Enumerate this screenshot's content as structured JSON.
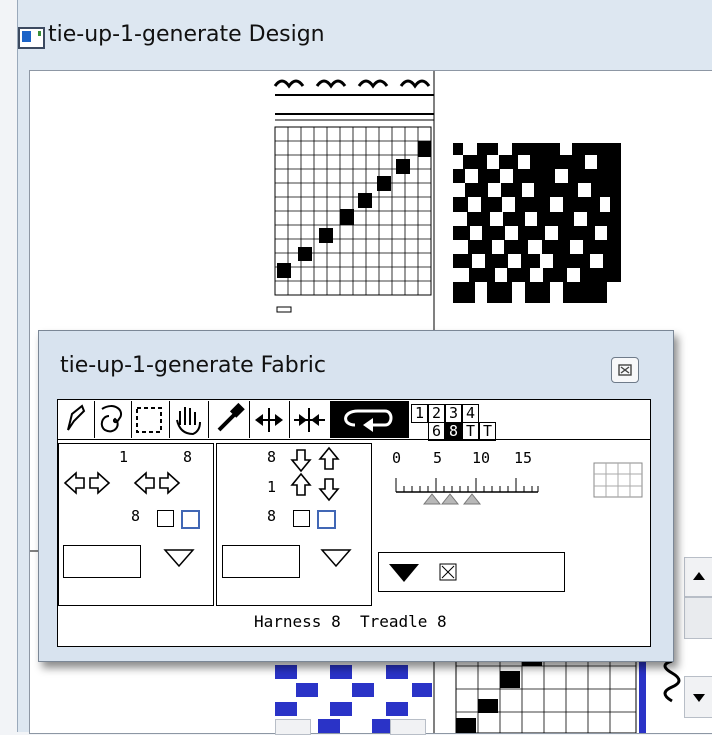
{
  "design_window": {
    "title": "tie-up-1-generate Design"
  },
  "fabric_window": {
    "title": "tie-up-1-generate Fabric",
    "view_selector": [
      "1",
      "2",
      "3",
      "4",
      "6",
      "8",
      "T",
      "T"
    ],
    "left_panel": {
      "top_left": "1",
      "top_right": "8",
      "count": "8"
    },
    "middle_panel": {
      "top": "8",
      "middle": "1",
      "count": "8"
    },
    "ruler": {
      "ticks": [
        "0",
        "5",
        "10",
        "15"
      ]
    },
    "status": "Harness 8  Treadle 8"
  },
  "icons": {
    "app": "design-icon",
    "pencil": "pencil-icon",
    "lasso": "lasso-icon",
    "selection": "selection-icon",
    "hand": "hand-icon",
    "dropper": "eyedropper-icon",
    "expand": "expand-icon",
    "compress": "compress-icon",
    "loop": "loop-icon"
  }
}
